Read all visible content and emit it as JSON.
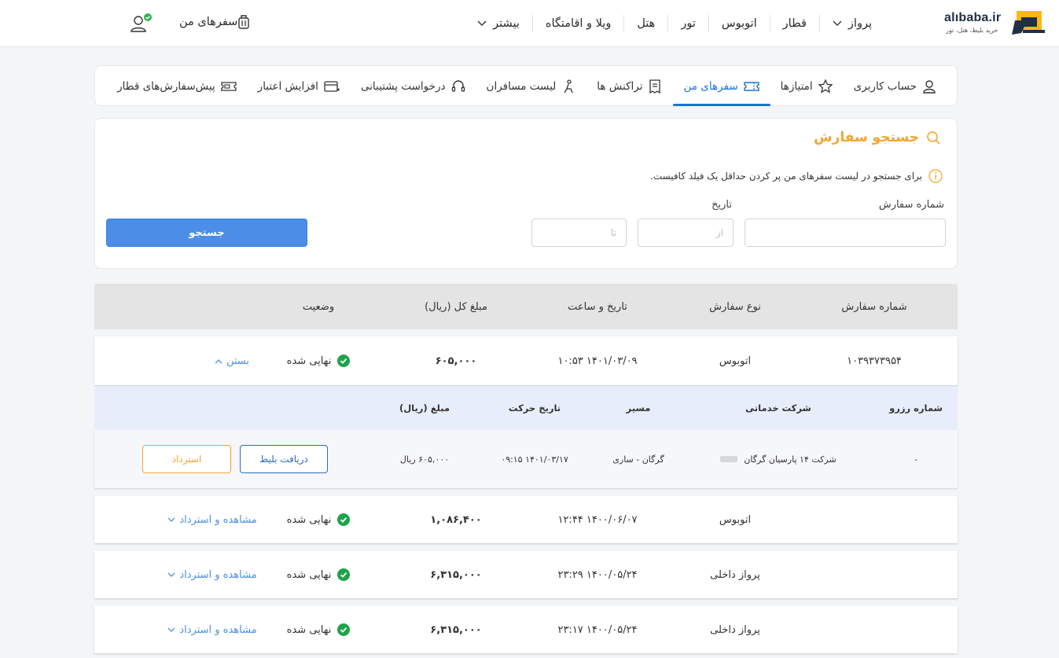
{
  "header": {
    "logo_text": "alıbaba.ir",
    "logo_tagline": "خرید بلیط، هتل، تور",
    "nav": [
      {
        "label": "پرواز",
        "has_dropdown": true
      },
      {
        "label": "قطار",
        "has_dropdown": false
      },
      {
        "label": "اتوبوس",
        "has_dropdown": false
      },
      {
        "label": "تور",
        "has_dropdown": false
      },
      {
        "label": "هتل",
        "has_dropdown": false
      },
      {
        "label": "ویلا و اقامتگاه",
        "has_dropdown": false
      },
      {
        "label": "بیشتر",
        "has_dropdown": true
      }
    ],
    "my_trips_label": "سفرهای من"
  },
  "tabs": [
    {
      "label": "حساب کاربری",
      "icon": "user-icon",
      "active": false
    },
    {
      "label": "امتیازها",
      "icon": "star-icon",
      "active": false
    },
    {
      "label": "سفرهای من",
      "icon": "ticket-icon",
      "active": true
    },
    {
      "label": "تراکنش ها",
      "icon": "receipt-icon",
      "active": false
    },
    {
      "label": "لیست مسافران",
      "icon": "passenger-icon",
      "active": false
    },
    {
      "label": "درخواست پشتیبانی",
      "icon": "headset-icon",
      "active": false
    },
    {
      "label": "افزایش اعتبار",
      "icon": "credit-card-icon",
      "active": false
    },
    {
      "label": "پیش‌سفارش‌های قطار",
      "icon": "train-ticket-icon",
      "active": false
    }
  ],
  "search": {
    "title": "جستجو سفارش",
    "hint": "برای جستجو در لیست سفرهای من پر کردن حداقل یک فیلد کافیست.",
    "order_number_label": "شماره سفارش",
    "order_number_value": "",
    "date_label": "تاریخ",
    "from_placeholder": "از",
    "to_placeholder": "تا",
    "button_label": "جستجو"
  },
  "table": {
    "columns": [
      "شماره سفارش",
      "نوع سفارش",
      "تاریخ و ساعت",
      "مبلغ کل (ریال)",
      "وضعیت"
    ],
    "rows": [
      {
        "order_number": "۱۰۳۹۳۷۳۹۵۴",
        "type": "اتوبوس",
        "datetime": "۱۴۰۱/۰۳/۰۹  ۱۰:۵۳",
        "amount": "۶۰۵,۰۰۰",
        "status": "نهایی شده",
        "toggle": "بستن",
        "expanded": true
      },
      {
        "order_number": "",
        "type": "اتوبوس",
        "datetime": "۱۴۰۰/۰۶/۰۷  ۱۲:۴۴",
        "amount": "۱,۰۸۶,۴۰۰",
        "status": "نهایی شده",
        "toggle": "مشاهده و استرداد",
        "expanded": false
      },
      {
        "order_number": "",
        "type": "پرواز داخلی",
        "datetime": "۱۴۰۰/۰۵/۲۴  ۲۳:۲۹",
        "amount": "۶,۳۱۵,۰۰۰",
        "status": "نهایی شده",
        "toggle": "مشاهده و استرداد",
        "expanded": false
      },
      {
        "order_number": "",
        "type": "پرواز داخلی",
        "datetime": "۱۴۰۰/۰۵/۲۴  ۲۳:۱۷",
        "amount": "۶,۳۱۵,۰۰۰",
        "status": "نهایی شده",
        "toggle": "مشاهده و استرداد",
        "expanded": false
      }
    ]
  },
  "detail": {
    "columns": [
      "شماره رزرو",
      "شرکت خدماتی",
      "مسیر",
      "تاریخ حرکت",
      "مبلغ (ریال)"
    ],
    "reservation_number": "-",
    "company": "شرکت ۱۴ پارسیان گرگان",
    "route": "گرگان - ساری",
    "departure": "۱۴۰۱/۰۳/۱۷  ۰۹:۱۵",
    "amount": "۶۰۵,۰۰۰ ریال",
    "download_label": "دریافت بلیط",
    "refund_label": "استرداد"
  },
  "colors": {
    "brand_blue": "#1a73d9",
    "accent_orange": "#f2a531",
    "success_green": "#3c9a3c"
  }
}
